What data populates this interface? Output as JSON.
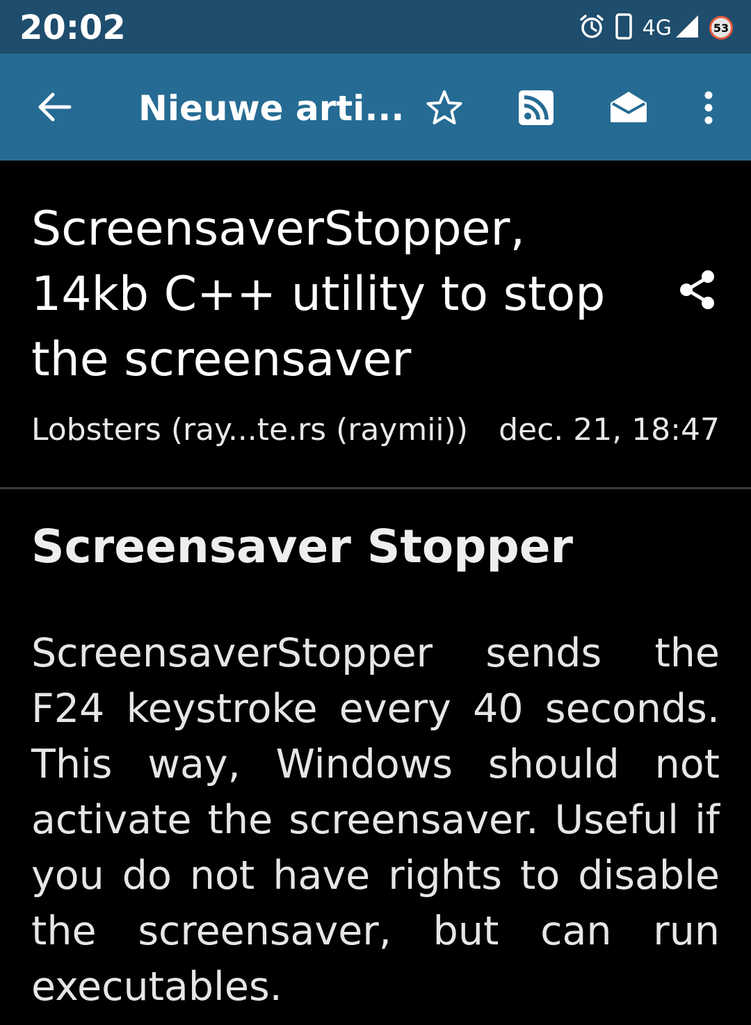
{
  "status_bar": {
    "time": "20:02",
    "network": "4G",
    "battery_level": "53",
    "icons": [
      "alarm-icon",
      "phone-icon",
      "signal-icon",
      "battery-icon"
    ]
  },
  "toolbar": {
    "title": "Nieuwe arti...",
    "icons": [
      "back-arrow-icon",
      "star-icon",
      "rss-icon",
      "mark-read-envelope-icon",
      "more-vert-icon"
    ]
  },
  "article": {
    "title": "ScreensaverStopper, 14kb C++ utility to stop the screensaver",
    "source": "Lobsters (ray...te.rs (raymii))",
    "date": "dec. 21, 18:47",
    "share_icon": "share-icon"
  },
  "content": {
    "heading": "Screensaver Stopper",
    "body": "ScreensaverStopper sends the F24 keystroke every 40 seconds. This way, Windows should not activate the screensaver. Useful if you do not have rights to disable the screensaver, but can run executables."
  },
  "colors": {
    "status_bar_bg": "#1e4d6d",
    "toolbar_bg": "#256b93",
    "page_bg": "#000000",
    "text": "#ffffff"
  }
}
